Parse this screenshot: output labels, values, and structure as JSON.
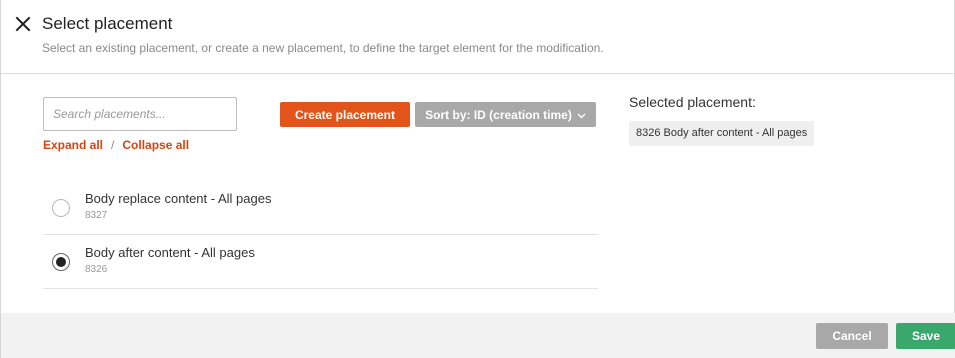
{
  "dialog": {
    "title": "Select placement",
    "subtitle": "Select an existing placement, or create a new placement, to define the target element for the modification.",
    "close_icon": "close-icon"
  },
  "search": {
    "placeholder": "Search placements...",
    "value": ""
  },
  "links": {
    "expand_all": "Expand all",
    "separator": "/",
    "collapse_all": "Collapse all"
  },
  "toolbar": {
    "create_label": "Create placement",
    "sort_label": "Sort by: ID (creation time)",
    "sort_icon": "chevron-down-icon"
  },
  "placements": [
    {
      "name": "Body replace content - All pages",
      "id": "8327",
      "selected": false
    },
    {
      "name": "Body after content - All pages",
      "id": "8326",
      "selected": true
    }
  ],
  "selected": {
    "label": "Selected placement:",
    "value": "8326 Body after content - All pages"
  },
  "footer": {
    "cancel_label": "Cancel",
    "save_label": "Save"
  },
  "colors": {
    "accent": "#e2541a",
    "neutral_button": "#a8a8a8",
    "save": "#3aa76d",
    "link": "#d9430f"
  }
}
